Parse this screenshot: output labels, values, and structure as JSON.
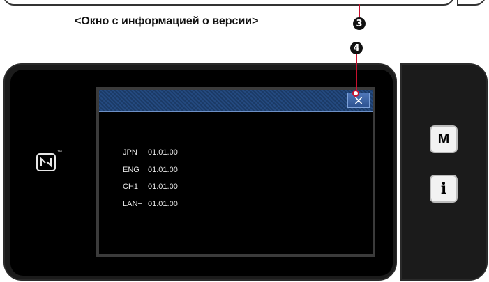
{
  "caption": "<Окно с информацией о версии>",
  "callouts": {
    "three": "3",
    "four": "4"
  },
  "dialog": {
    "close_label": "×",
    "versions": [
      {
        "name": "JPN",
        "value": "01.01.00"
      },
      {
        "name": "ENG",
        "value": "01.01.00"
      },
      {
        "name": "CH1",
        "value": "01.01.00"
      },
      {
        "name": "LAN+",
        "value": "01.01.00"
      }
    ]
  },
  "side_buttons": {
    "m_label": "M",
    "info_label": "i"
  },
  "nfc": {
    "tm": "™"
  },
  "colors": {
    "callout_line": "#c8102e",
    "header_blue": "#1b3a66"
  }
}
